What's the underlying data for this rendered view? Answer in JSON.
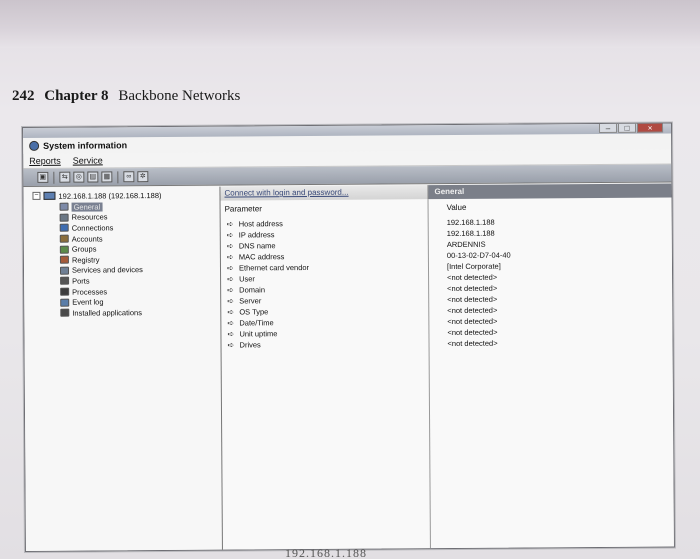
{
  "book": {
    "page_number": "242",
    "chapter": "Chapter 8",
    "section_title": "Backbone Networks"
  },
  "window": {
    "title": "System information",
    "controls": [
      "–",
      "□",
      "×"
    ]
  },
  "menu": [
    "Reports",
    "Service"
  ],
  "tree": {
    "root": "192.168.1.188 (192.168.1.188)",
    "items": [
      {
        "label": "General",
        "icon": "general-icon",
        "selected": true
      },
      {
        "label": "Resources",
        "icon": "resources-icon"
      },
      {
        "label": "Connections",
        "icon": "connections-icon"
      },
      {
        "label": "Accounts",
        "icon": "accounts-icon"
      },
      {
        "label": "Groups",
        "icon": "groups-icon"
      },
      {
        "label": "Registry",
        "icon": "registry-icon"
      },
      {
        "label": "Services and devices",
        "icon": "services-icon"
      },
      {
        "label": "Ports",
        "icon": "ports-icon"
      },
      {
        "label": "Processes",
        "icon": "processes-icon"
      },
      {
        "label": "Event log",
        "icon": "event-log-icon"
      },
      {
        "label": "Installed applications",
        "icon": "installed-apps-icon"
      }
    ]
  },
  "detail": {
    "connect_link": "Connect with login and password...",
    "tab_title": "General",
    "param_header": "Parameter",
    "value_header": "Value",
    "rows": [
      {
        "param": "Host address",
        "value": "192.168.1.188"
      },
      {
        "param": "IP address",
        "value": "192.168.1.188"
      },
      {
        "param": "DNS name",
        "value": "ARDENNIS"
      },
      {
        "param": "MAC address",
        "value": "00-13-02-D7-04-40"
      },
      {
        "param": "Ethernet card vendor",
        "value": "[Intel Corporate]"
      },
      {
        "param": "User",
        "value": "<not detected>"
      },
      {
        "param": "Domain",
        "value": "<not detected>"
      },
      {
        "param": "Server",
        "value": "<not detected>"
      },
      {
        "param": "OS Type",
        "value": "<not detected>"
      },
      {
        "param": "Date/Time",
        "value": "<not detected>"
      },
      {
        "param": "Unit uptime",
        "value": "<not detected>"
      },
      {
        "param": "Drives",
        "value": "<not detected>"
      }
    ]
  },
  "bottom_fragment": "192.168.1.188",
  "colors": {
    "selection": "#7a8192",
    "header_bar": "#7b7f89",
    "link": "#3b4b7a"
  }
}
